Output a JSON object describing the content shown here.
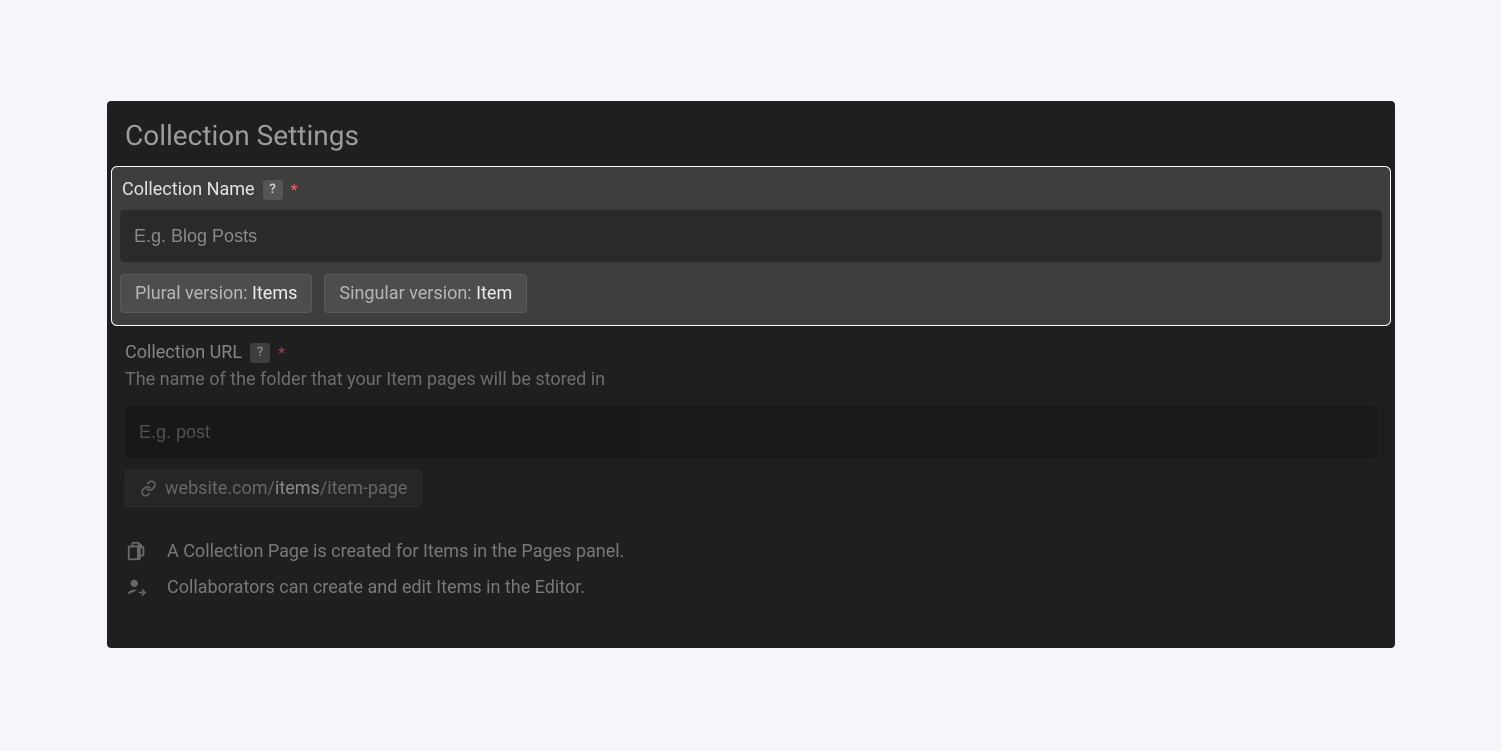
{
  "panel": {
    "title": "Collection Settings"
  },
  "name_section": {
    "label": "Collection Name",
    "help": "?",
    "required_mark": "*",
    "placeholder": "E.g. Blog Posts",
    "value": "",
    "plural_label": "Plural version: ",
    "plural_value": "Items",
    "singular_label": "Singular version: ",
    "singular_value": "Item"
  },
  "url_section": {
    "label": "Collection URL",
    "help": "?",
    "required_mark": "*",
    "description": "The name of the folder that your Item pages will be stored in",
    "placeholder": "E.g. post",
    "value": "",
    "preview_prefix": "website.com/",
    "preview_slug": "items",
    "preview_suffix": "/item-page"
  },
  "info": {
    "page_note": "A Collection Page is created for Items in the Pages panel.",
    "collab_note": "Collaborators can create and edit Items in the Editor."
  }
}
